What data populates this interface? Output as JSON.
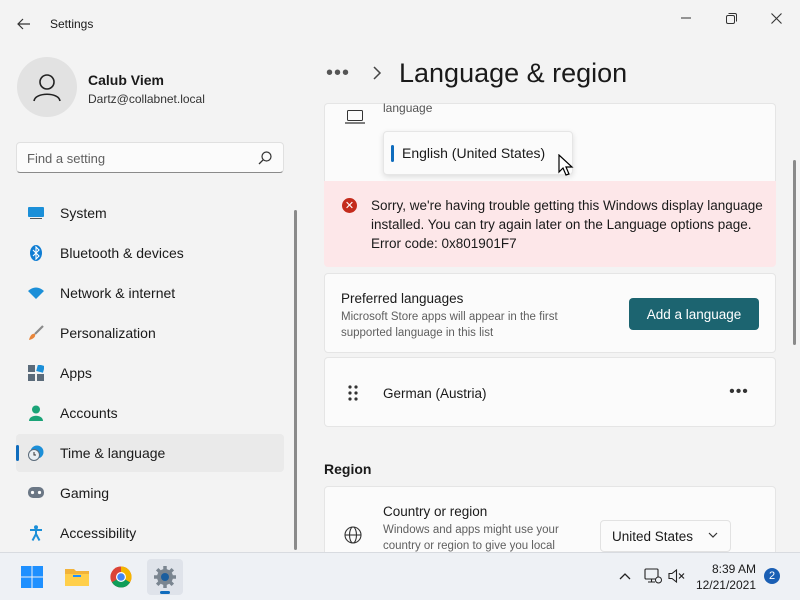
{
  "window": {
    "title": "Settings",
    "controls": [
      "minimize",
      "maximize",
      "close"
    ]
  },
  "profile": {
    "name": "Calub Viem",
    "email": "Dartz@collabnet.local"
  },
  "search": {
    "placeholder": "Find a setting"
  },
  "sidebar": {
    "items": [
      {
        "label": "System",
        "icon": "system-icon",
        "active": false
      },
      {
        "label": "Bluetooth & devices",
        "icon": "bluetooth-icon",
        "active": false
      },
      {
        "label": "Network & internet",
        "icon": "wifi-icon",
        "active": false
      },
      {
        "label": "Personalization",
        "icon": "brush-icon",
        "active": false
      },
      {
        "label": "Apps",
        "icon": "apps-icon",
        "active": false
      },
      {
        "label": "Accounts",
        "icon": "accounts-icon",
        "active": false
      },
      {
        "label": "Time & language",
        "icon": "time-language-icon",
        "active": true
      },
      {
        "label": "Gaming",
        "icon": "gaming-icon",
        "active": false
      },
      {
        "label": "Accessibility",
        "icon": "accessibility-icon",
        "active": false
      }
    ]
  },
  "header": {
    "more": "•••",
    "title": "Language & region"
  },
  "display_language": {
    "label": "language",
    "selected": "English (United States)"
  },
  "error": {
    "message": "Sorry, we're having trouble getting this Windows display language installed. You can try again later on the Language options page. Error code: 0x801901F7"
  },
  "preferred": {
    "title": "Preferred languages",
    "description": "Microsoft Store apps will appear in the first supported language in this list",
    "button": "Add a language"
  },
  "languages": [
    {
      "name": "German (Austria)"
    }
  ],
  "region": {
    "heading": "Region",
    "title": "Country or region",
    "description": "Windows and apps might use your country or region to give you local",
    "selected": "United States"
  },
  "taskbar": {
    "apps": [
      "start-icon",
      "file-explorer-icon",
      "chrome-icon",
      "settings-icon"
    ],
    "time": "8:39 AM",
    "date": "12/21/2021",
    "notifications": "2"
  },
  "colors": {
    "accent": "#0f6cbd",
    "button": "#1c6470",
    "error_bg": "#fde7e9",
    "error_icon": "#c42b1c"
  }
}
